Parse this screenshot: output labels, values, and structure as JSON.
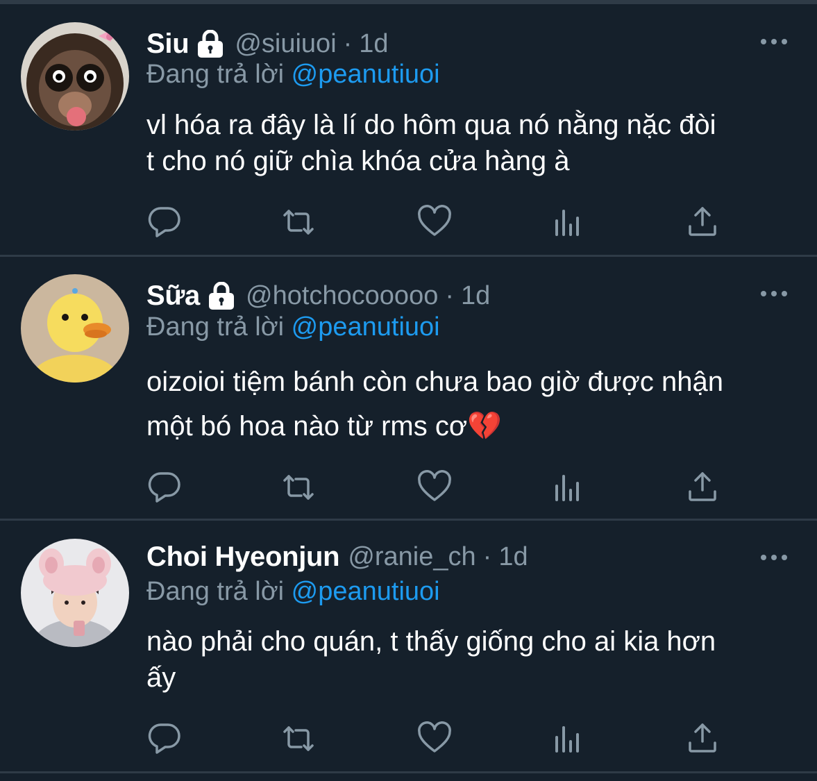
{
  "tweets": [
    {
      "display_name": "Siu",
      "locked": true,
      "handle": "@siuiuoi",
      "separator": "·",
      "time": "1d",
      "reply_prefix": "Đang trả lời",
      "reply_to": "@peanutiuoi",
      "text_lines": [
        "vl hóa ra đây là lí do hôm qua nó nằng nặc đòi",
        "t cho nó giữ chìa khóa cửa hàng à"
      ],
      "avatar_icon": "monkey-with-pink-bow"
    },
    {
      "display_name": "Sữa",
      "locked": true,
      "handle": "@hotchocooooo",
      "separator": "·",
      "time": "1d",
      "reply_prefix": "Đang trả lời",
      "reply_to": "@peanutiuoi",
      "text_lines": [
        "oizoioi tiệm bánh còn chưa bao giờ được nhận",
        "một bó hoa nào từ rms cơ💔"
      ],
      "avatar_icon": "yellow-duck-plush"
    },
    {
      "display_name": "Choi Hyeonjun",
      "locked": false,
      "handle": "@ranie_ch",
      "separator": "·",
      "time": "1d",
      "reply_prefix": "Đang trả lời",
      "reply_to": "@peanutiuoi",
      "text_lines": [
        "nào phải cho quán, t thấy giống cho ai kia hơn",
        "ấy"
      ],
      "avatar_icon": "person-with-bunny-ear-hat"
    }
  ],
  "actions": [
    "reply-icon",
    "retweet-icon",
    "like-icon",
    "views-icon",
    "share-icon"
  ],
  "colors": {
    "background": "#15202b",
    "divider": "#2f3b47",
    "text_primary": "#ffffff",
    "text_secondary": "#8899a6",
    "accent": "#1d9bf0"
  }
}
